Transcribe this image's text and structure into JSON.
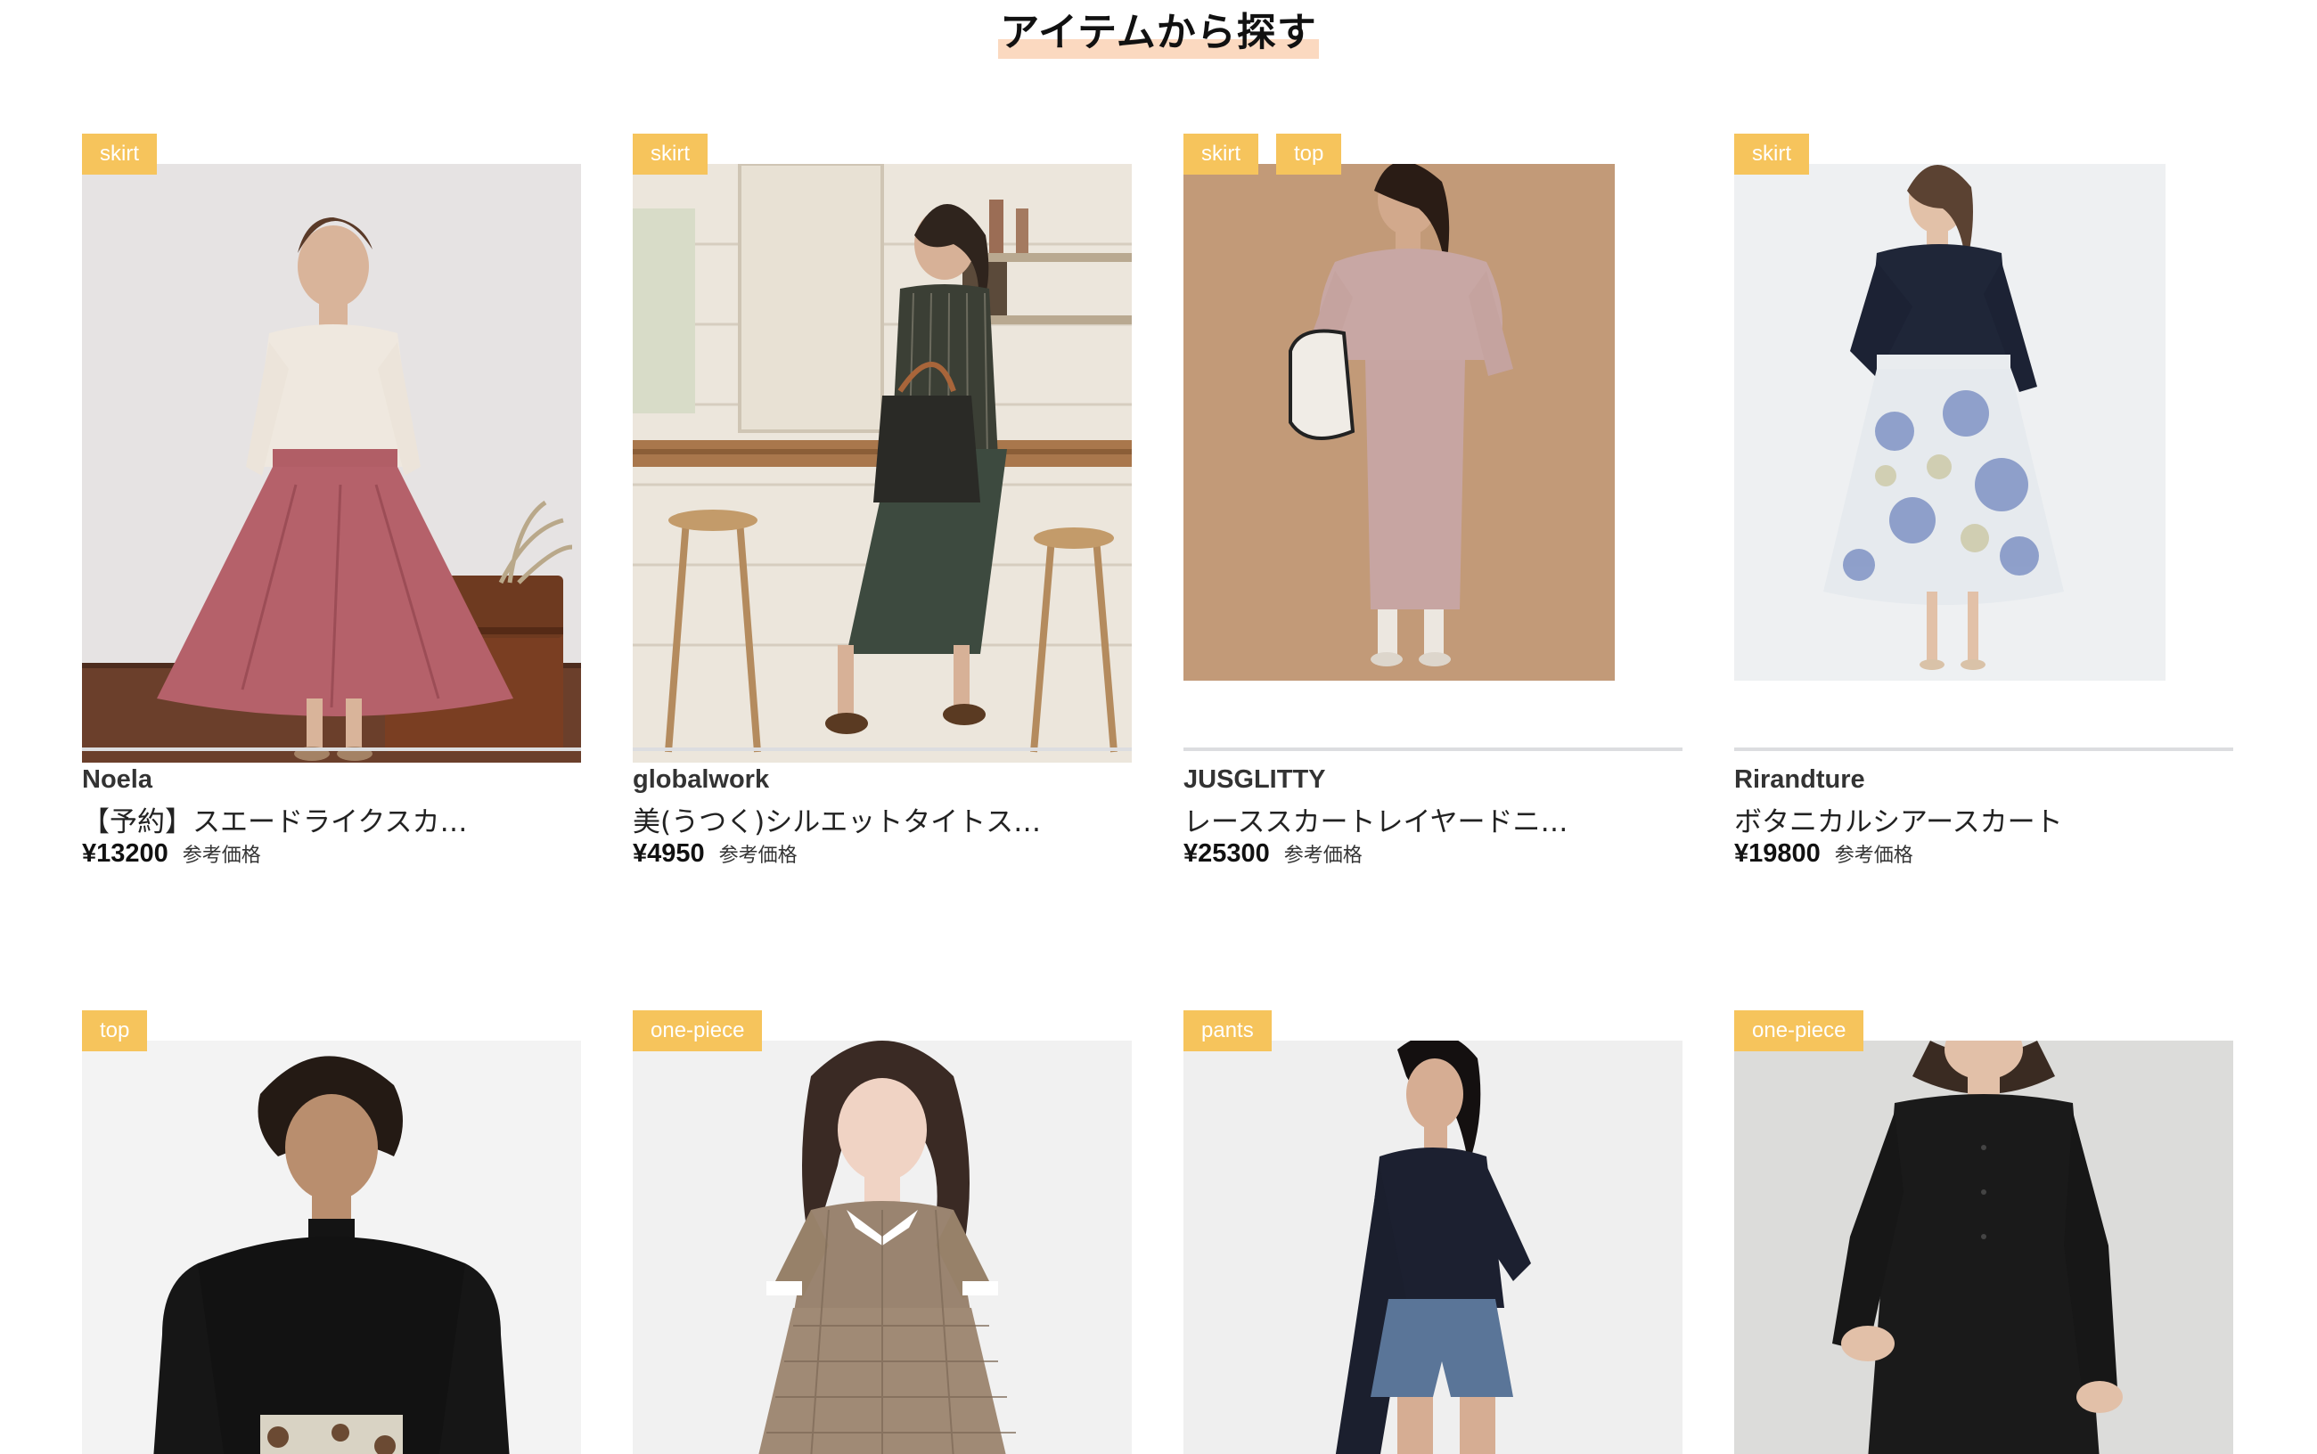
{
  "section": {
    "title": "アイテムから探す"
  },
  "items": [
    {
      "tags": [
        "skirt"
      ],
      "brand": "Noela",
      "name": "【予約】スエードライクスカ…",
      "price": "¥13200",
      "price_note": "参考価格"
    },
    {
      "tags": [
        "skirt"
      ],
      "brand": "globalwork",
      "name": "美(うつく)シルエットタイトス…",
      "price": "¥4950",
      "price_note": "参考価格"
    },
    {
      "tags": [
        "skirt",
        "top"
      ],
      "brand": "JUSGLITTY",
      "name": "レーススカートレイヤードニ…",
      "price": "¥25300",
      "price_note": "参考価格"
    },
    {
      "tags": [
        "skirt"
      ],
      "brand": "Rirandture",
      "name": "ボタニカルシアースカート",
      "price": "¥19800",
      "price_note": "参考価格"
    },
    {
      "tags": [
        "top"
      ]
    },
    {
      "tags": [
        "one-piece"
      ]
    },
    {
      "tags": [
        "pants"
      ]
    },
    {
      "tags": [
        "one-piece"
      ]
    }
  ],
  "colors": {
    "tag_bg": "#f6c45c",
    "title_highlight": "#fbd9c0",
    "divider": "#dcdde0"
  }
}
